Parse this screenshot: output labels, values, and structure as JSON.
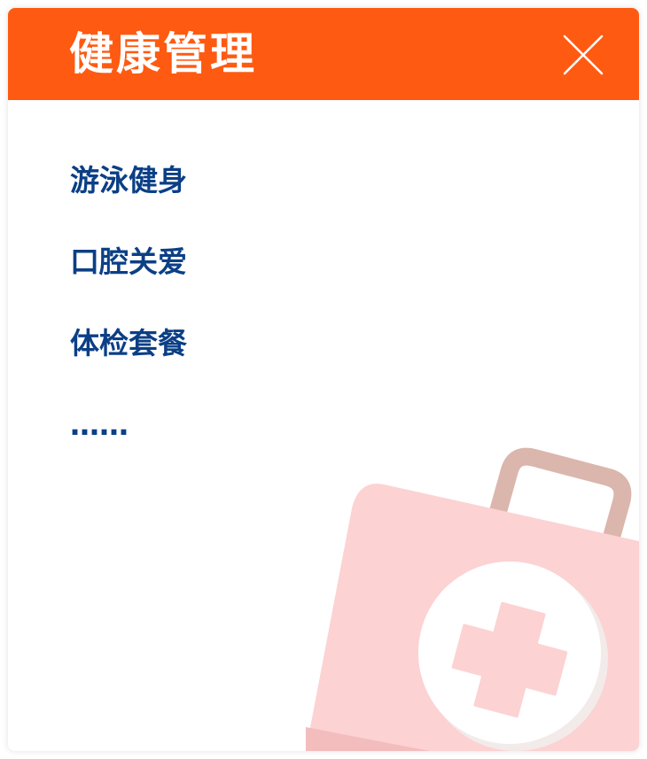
{
  "dialog": {
    "title": "健康管理",
    "close_icon": "close-icon",
    "header_color": "#ff5a11",
    "text_color": "#0b3f86"
  },
  "menu": {
    "items": [
      {
        "label": "游泳健身"
      },
      {
        "label": "口腔关爱"
      },
      {
        "label": "体检套餐"
      },
      {
        "label": "……"
      }
    ]
  },
  "illustration": {
    "icon": "first-aid-kit-icon"
  }
}
